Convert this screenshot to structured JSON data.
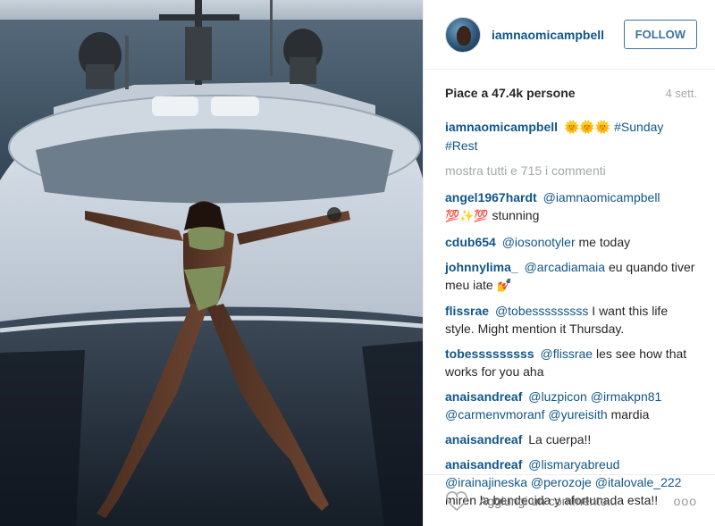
{
  "header": {
    "username": "iamnaomicampbell",
    "follow_label": "FOLLOW"
  },
  "meta": {
    "likes": "Piace a 47.4k persone",
    "time": "4 sett."
  },
  "caption": {
    "user": "iamnaomicampbell",
    "emoji": "🌞🌞🌞",
    "tags": "#Sunday #Rest"
  },
  "show_all": "mostra tutti e 715 i commenti",
  "comments": [
    {
      "user": "angel1967hardt",
      "mention": "@iamnaomicampbell",
      "emoji": "💯✨💯",
      "text": "stunning"
    },
    {
      "user": "cdub654",
      "mention": "@iosonotyler",
      "text": "me today"
    },
    {
      "user": "johnnylima_",
      "mention": "@arcadiamaia",
      "text": "eu quando tiver meu iate",
      "emoji": "💅"
    },
    {
      "user": "flissrae",
      "mention": "@tobesssssssss",
      "text": "I want this life style. Might mention it Thursday."
    },
    {
      "user": "tobesssssssss",
      "mention": "@flissrae",
      "text": "les see how that works for you aha"
    },
    {
      "user": "anaisandreaf",
      "mention": "@luzpicon @irmakpn81 @carmenvmoranf @yureisith",
      "text": "mardia"
    },
    {
      "user": "anaisandreaf",
      "text": "La cuerpa!!"
    },
    {
      "user": "anaisandreaf",
      "mention": "@lismaryabreud @irainajineska @perozoje @italovale_222",
      "text": "miren la bendecida y afortunada esta!!"
    }
  ],
  "footer": {
    "placeholder": "Aggiungi un commento...",
    "more": "ooo"
  },
  "colors": {
    "link": "#125688",
    "follow": "#3f729b",
    "muted": "#a5a7aa"
  },
  "icons": {
    "like": "heart-outline-icon",
    "more": "ellipsis-icon"
  }
}
